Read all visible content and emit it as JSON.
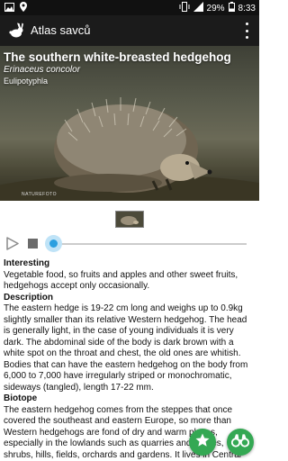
{
  "status_bar": {
    "battery_percent": "29%",
    "time": "8:33",
    "icons": [
      "image-icon",
      "location-icon",
      "vibrate-icon",
      "signal-icon",
      "battery-icon"
    ]
  },
  "app_bar": {
    "title": "Atlas savců",
    "icons": [
      "rabbit-logo-icon",
      "overflow-menu-icon"
    ]
  },
  "hero": {
    "common_name": "The southern white-breasted hedgehog",
    "latin_name": "Erinaceus concolor",
    "order": "Eulipotyphla",
    "photo_credit": "NATUREFOTO"
  },
  "player": {
    "controls": [
      "play-icon",
      "stop-icon"
    ],
    "progress": 0.0
  },
  "sections": [
    {
      "heading": "Interesting",
      "text": "Vegetable food, so fruits and apples and other sweet fruits, hedgehogs accept only occasionally."
    },
    {
      "heading": "Description",
      "text": "The eastern hedge is 19-22 cm long and weighs up to 0.9kg slightly smaller than its relative Western hedgehog. The head is generally light, in the case of young individuals it is very dark. The abdominal side of the body is dark brown with a white spot on the throat and chest, the old ones are whitish. Bodies that can have the eastern hedgehog on the body from 6,000 to 7,000 have irregularly striped or monochromatic, sideways (tangled), length 17-22 mm."
    },
    {
      "heading": "Biotope",
      "text": "The eastern hedgehog comes from the steppes that once covered the southeast and eastern Europe, so more than Western hedgehogs are fond of dry and warm places, especially in the lowlands such as quarries and gorges, shrubs, hills, fields, orchards and gardens. It lives in Central and Eastern Europe, the Balkan peninsula, the western border of Poland, the Central"
    }
  ],
  "fabs": {
    "icons": [
      "star-icon",
      "binoculars-icon"
    ],
    "color": "#34a853"
  },
  "colors": {
    "status_bar": "#111111",
    "app_bar": "#1b1b1b",
    "accent": "#2a9fe0"
  }
}
